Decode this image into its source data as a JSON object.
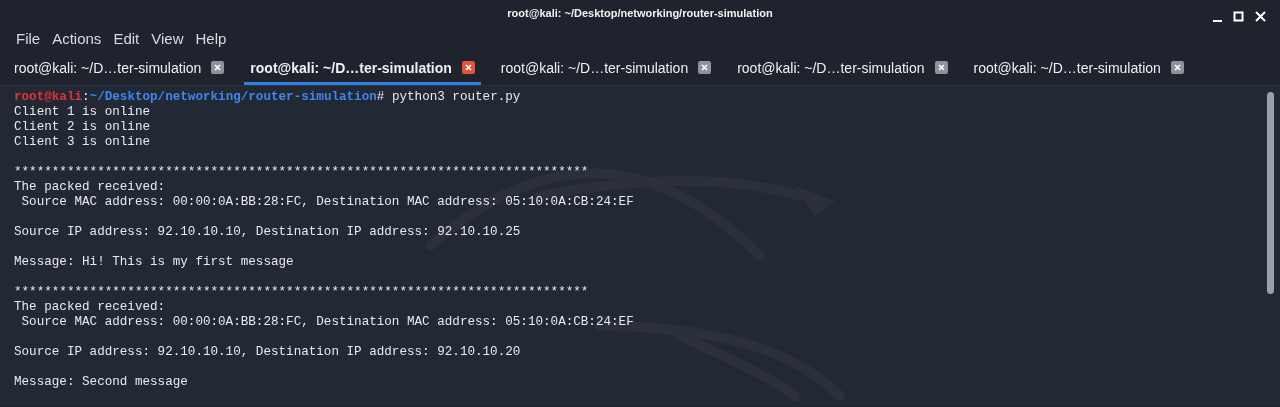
{
  "window": {
    "title": "root@kali: ~/Desktop/networking/router-simulation"
  },
  "menu": [
    "File",
    "Actions",
    "Edit",
    "View",
    "Help"
  ],
  "tabs": [
    {
      "label": "root@kali: ~/D…ter-simulation",
      "selected": false
    },
    {
      "label": "root@kali: ~/D…ter-simulation",
      "selected": true
    },
    {
      "label": "root@kali: ~/D…ter-simulation",
      "selected": false
    },
    {
      "label": "root@kali: ~/D…ter-simulation",
      "selected": false
    },
    {
      "label": "root@kali: ~/D…ter-simulation",
      "selected": false
    }
  ],
  "terminal": {
    "lines": [
      {
        "kind": "prompt",
        "user": "root@kali",
        "separator": ":",
        "path": "~/Desktop/networking/router-simulation",
        "command": "# python3 router.py"
      },
      {
        "kind": "output",
        "text": "Client 1 is online"
      },
      {
        "kind": "output",
        "text": "Client 2 is online"
      },
      {
        "kind": "output",
        "text": "Client 3 is online"
      },
      {
        "kind": "blank"
      },
      {
        "kind": "output",
        "text": "****************************************************************************"
      },
      {
        "kind": "output",
        "text": "The packed received:"
      },
      {
        "kind": "output",
        "text": " Source MAC address: 00:00:0A:BB:28:FC, Destination MAC address: 05:10:0A:CB:24:EF"
      },
      {
        "kind": "blank"
      },
      {
        "kind": "output",
        "text": "Source IP address: 92.10.10.10, Destination IP address: 92.10.10.25"
      },
      {
        "kind": "blank"
      },
      {
        "kind": "output",
        "text": "Message: Hi! This is my first message"
      },
      {
        "kind": "blank"
      },
      {
        "kind": "output",
        "text": "****************************************************************************"
      },
      {
        "kind": "output",
        "text": "The packed received:"
      },
      {
        "kind": "output",
        "text": " Source MAC address: 00:00:0A:BB:28:FC, Destination MAC address: 05:10:0A:CB:24:EF"
      },
      {
        "kind": "blank"
      },
      {
        "kind": "output",
        "text": "Source IP address: 92.10.10.10, Destination IP address: 92.10.10.20"
      },
      {
        "kind": "blank"
      },
      {
        "kind": "output",
        "text": "Message: Second message"
      }
    ]
  }
}
